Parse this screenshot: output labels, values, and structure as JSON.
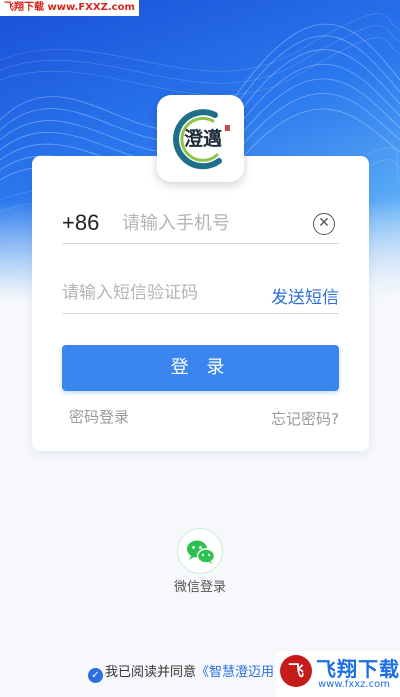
{
  "watermark": {
    "top_text": "飞翔下载 www.FXXZ.com",
    "bottom_brand": "飞翔下载",
    "bottom_url": "www.fxxz.com",
    "bottom_logo_char": "飞"
  },
  "app": {
    "logo_text": "澄邁"
  },
  "login_form": {
    "country_code": "+86",
    "phone_placeholder": "请输入手机号",
    "phone_value": "",
    "sms_placeholder": "请输入短信验证码",
    "sms_value": "",
    "send_sms_label": "发送短信",
    "login_button_label": "登 录",
    "password_login_label": "密码登录",
    "forgot_password_label": "忘记密码?"
  },
  "social_login": {
    "wechat_label": "微信登录"
  },
  "agreement": {
    "checked": true,
    "prefix_text": "我已阅读并同意",
    "link_text": "《智慧澄迈用"
  },
  "colors": {
    "accent": "#2b6fe0",
    "login_button": "#3a86ee",
    "wechat_green": "#2dc150"
  },
  "icons": {
    "clear": "clear-circle-icon",
    "wechat": "wechat-icon",
    "check": "check-circle-icon"
  }
}
